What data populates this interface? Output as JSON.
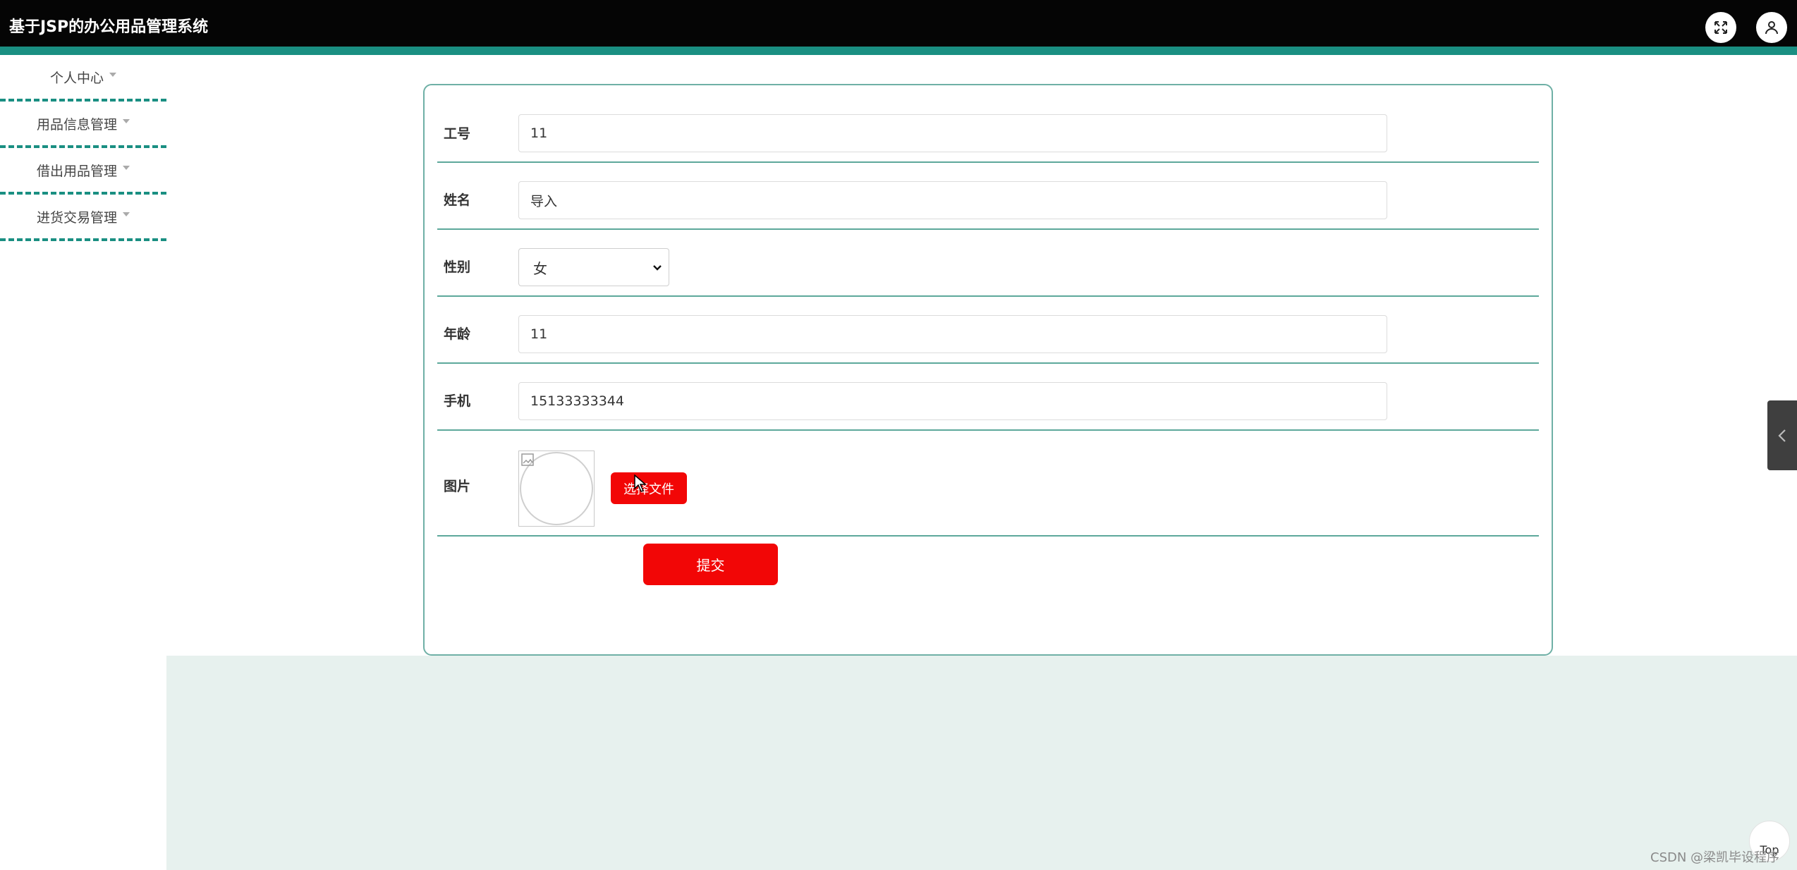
{
  "app": {
    "title": "基于JSP的办公用品管理系统"
  },
  "sidebar": {
    "items": [
      {
        "label": "个人中心"
      },
      {
        "label": "用品信息管理"
      },
      {
        "label": "借出用品管理"
      },
      {
        "label": "进货交易管理"
      }
    ]
  },
  "form": {
    "fields": [
      {
        "label": "工号",
        "value": "11"
      },
      {
        "label": "姓名",
        "value": "导入"
      },
      {
        "label": "性别",
        "value": "女"
      },
      {
        "label": "年龄",
        "value": "11"
      },
      {
        "label": "手机",
        "value": "15133333344"
      },
      {
        "label": "图片"
      }
    ],
    "choose_file_label": "选择文件",
    "submit_label": "提交"
  },
  "footer": {
    "top_label": "Top",
    "watermark": "CSDN @梁凯毕设程序"
  },
  "colors": {
    "accent": "#1a8f82",
    "button": "#f20606",
    "topbar": "#050505"
  },
  "icons": {
    "fullscreen": "fullscreen-icon",
    "user": "user-icon",
    "collapse": "chevron-left-icon"
  }
}
